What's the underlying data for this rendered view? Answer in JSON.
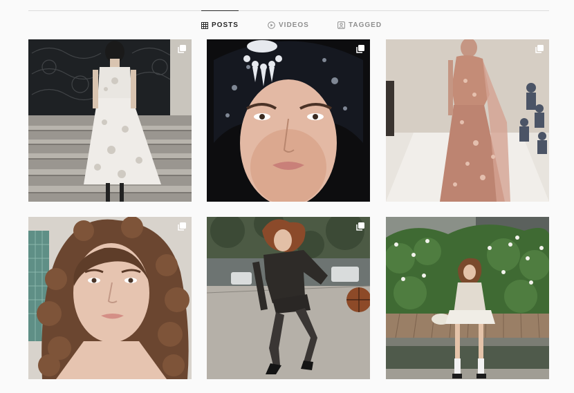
{
  "tabs": [
    {
      "label": "POSTS",
      "icon": "grid-icon",
      "active": true
    },
    {
      "label": "VIDEOS",
      "icon": "play-circle-icon",
      "active": false
    },
    {
      "label": "TAGGED",
      "icon": "tagged-user-icon",
      "active": false
    }
  ],
  "posts": [
    {
      "subject": "white-embellished-dress-runway",
      "icon": "multiple-photos-icon"
    },
    {
      "subject": "jeweled-turban-portrait",
      "icon": "multiple-photos-icon"
    },
    {
      "subject": "pink-sequin-gown-runway",
      "icon": "multiple-photos-icon"
    },
    {
      "subject": "curly-hair-portrait",
      "icon": "multiple-photos-icon"
    },
    {
      "subject": "basketball-street-photo",
      "icon": "multiple-photos-icon"
    },
    {
      "subject": "garden-bench-photo",
      "icon": "multiple-photos-icon"
    }
  ],
  "colors": {
    "divider": "#dbdbdb",
    "active_tab": "#262626",
    "inactive_tab": "#8e8e8e",
    "background": "#fafafa"
  }
}
